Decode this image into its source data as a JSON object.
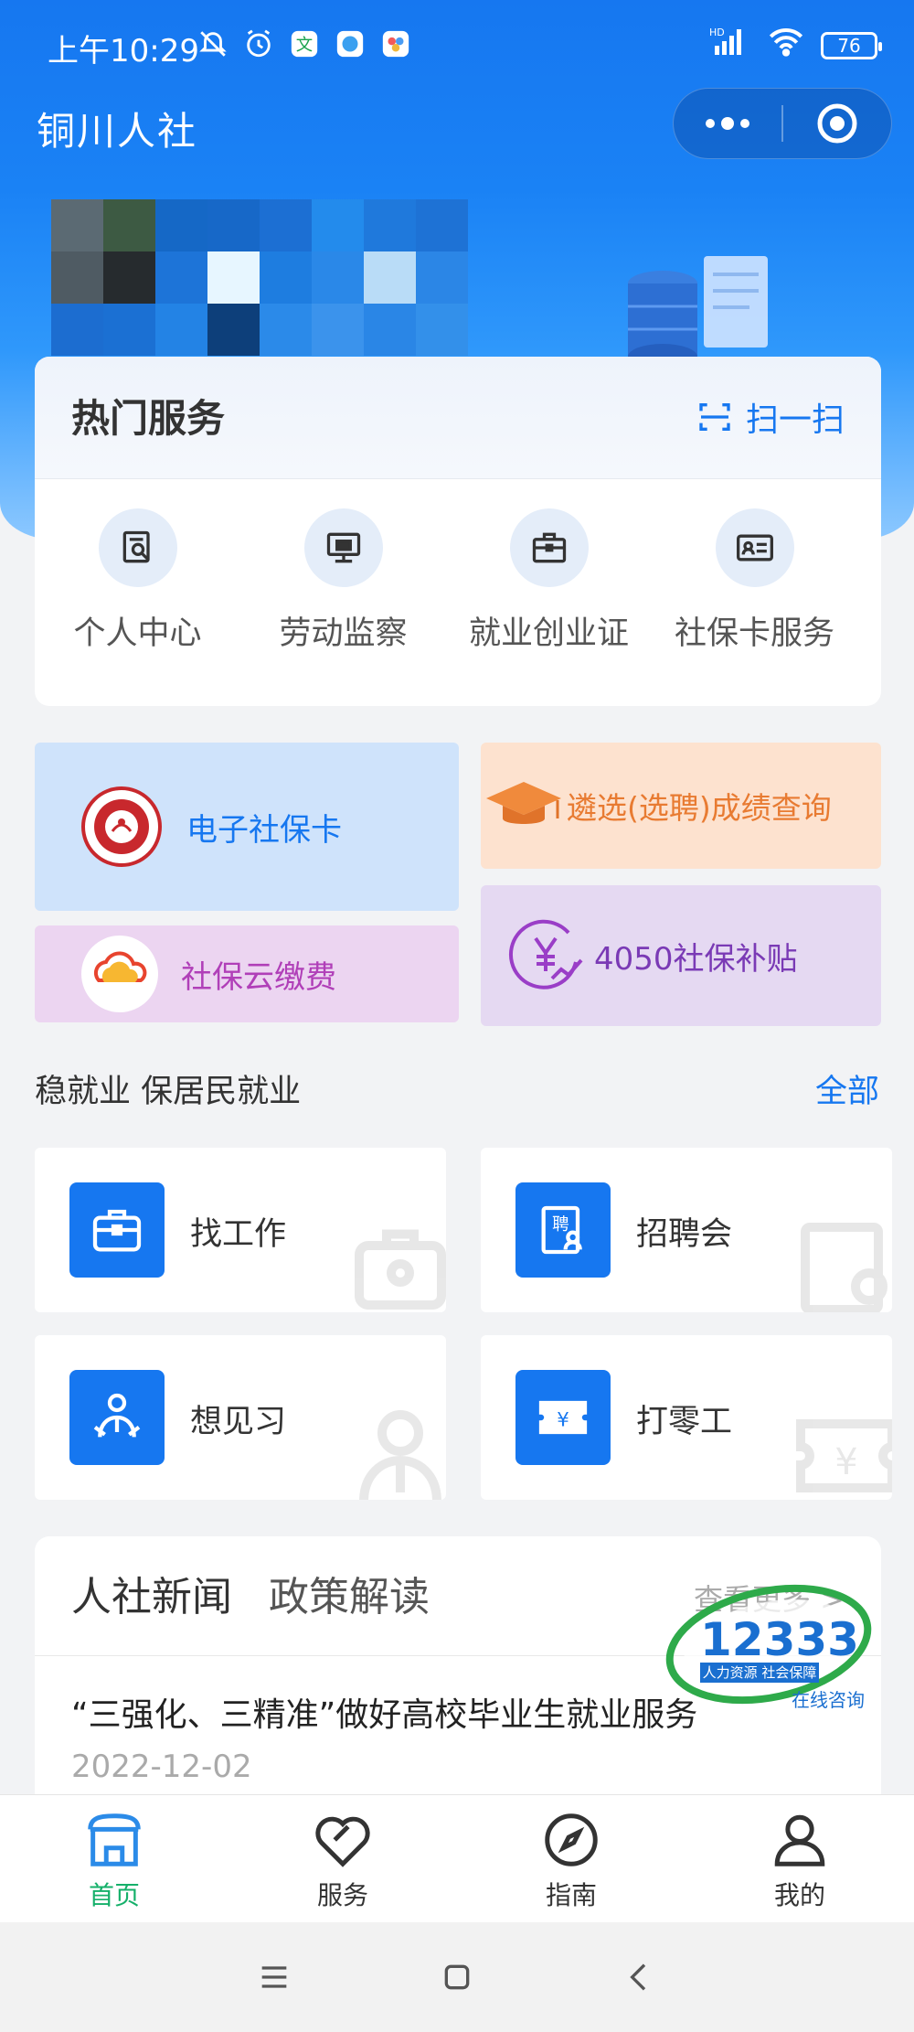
{
  "status_bar": {
    "time": "上午10:29",
    "battery": "76",
    "network": "HD"
  },
  "app": {
    "title": "铜川人社"
  },
  "hot_services": {
    "title": "热门服务",
    "scan_label": "扫一扫",
    "items": [
      {
        "label": "个人中心",
        "icon": "profile-search-icon"
      },
      {
        "label": "劳动监察",
        "icon": "monitor-icon"
      },
      {
        "label": "就业创业证",
        "icon": "briefcase-icon"
      },
      {
        "label": "社保卡服务",
        "icon": "id-card-icon"
      }
    ]
  },
  "tiles": {
    "e_card": "电子社保卡",
    "exam_query": "遴选(选聘)成绩查询",
    "cloud_pay": "社保云缴费",
    "subsidy": "4050社保补贴"
  },
  "employment": {
    "title": "稳就业 保居民就业",
    "all_label": "全部",
    "items": [
      {
        "label": "找工作",
        "icon": "briefcase-icon"
      },
      {
        "label": "招聘会",
        "icon": "recruit-icon"
      },
      {
        "label": "想见习",
        "icon": "trainee-icon"
      },
      {
        "label": "打零工",
        "icon": "yen-ticket-icon"
      }
    ]
  },
  "news": {
    "tabs": [
      "人社新闻",
      "政策解读"
    ],
    "more": "查看更多 >",
    "headline": "“三强化、三精准”做好高校毕业生就业服务",
    "date": "2022-12-02"
  },
  "badge": {
    "number": "12333",
    "subtitle": "人力资源 社会保障",
    "consult": "在线咨询"
  },
  "tabbar": [
    {
      "label": "首页",
      "icon": "home-icon",
      "active": true
    },
    {
      "label": "服务",
      "icon": "heart-tag-icon",
      "active": false
    },
    {
      "label": "指南",
      "icon": "compass-icon",
      "active": false
    },
    {
      "label": "我的",
      "icon": "user-icon",
      "active": false
    }
  ],
  "colors": {
    "primary": "#1677f0",
    "active_tab": "#15b06a",
    "tile_blue": "#cfe3fb",
    "tile_orange": "#fde2cf",
    "tile_pink": "#ecd5f1",
    "tile_purple": "#e5d9f2"
  }
}
